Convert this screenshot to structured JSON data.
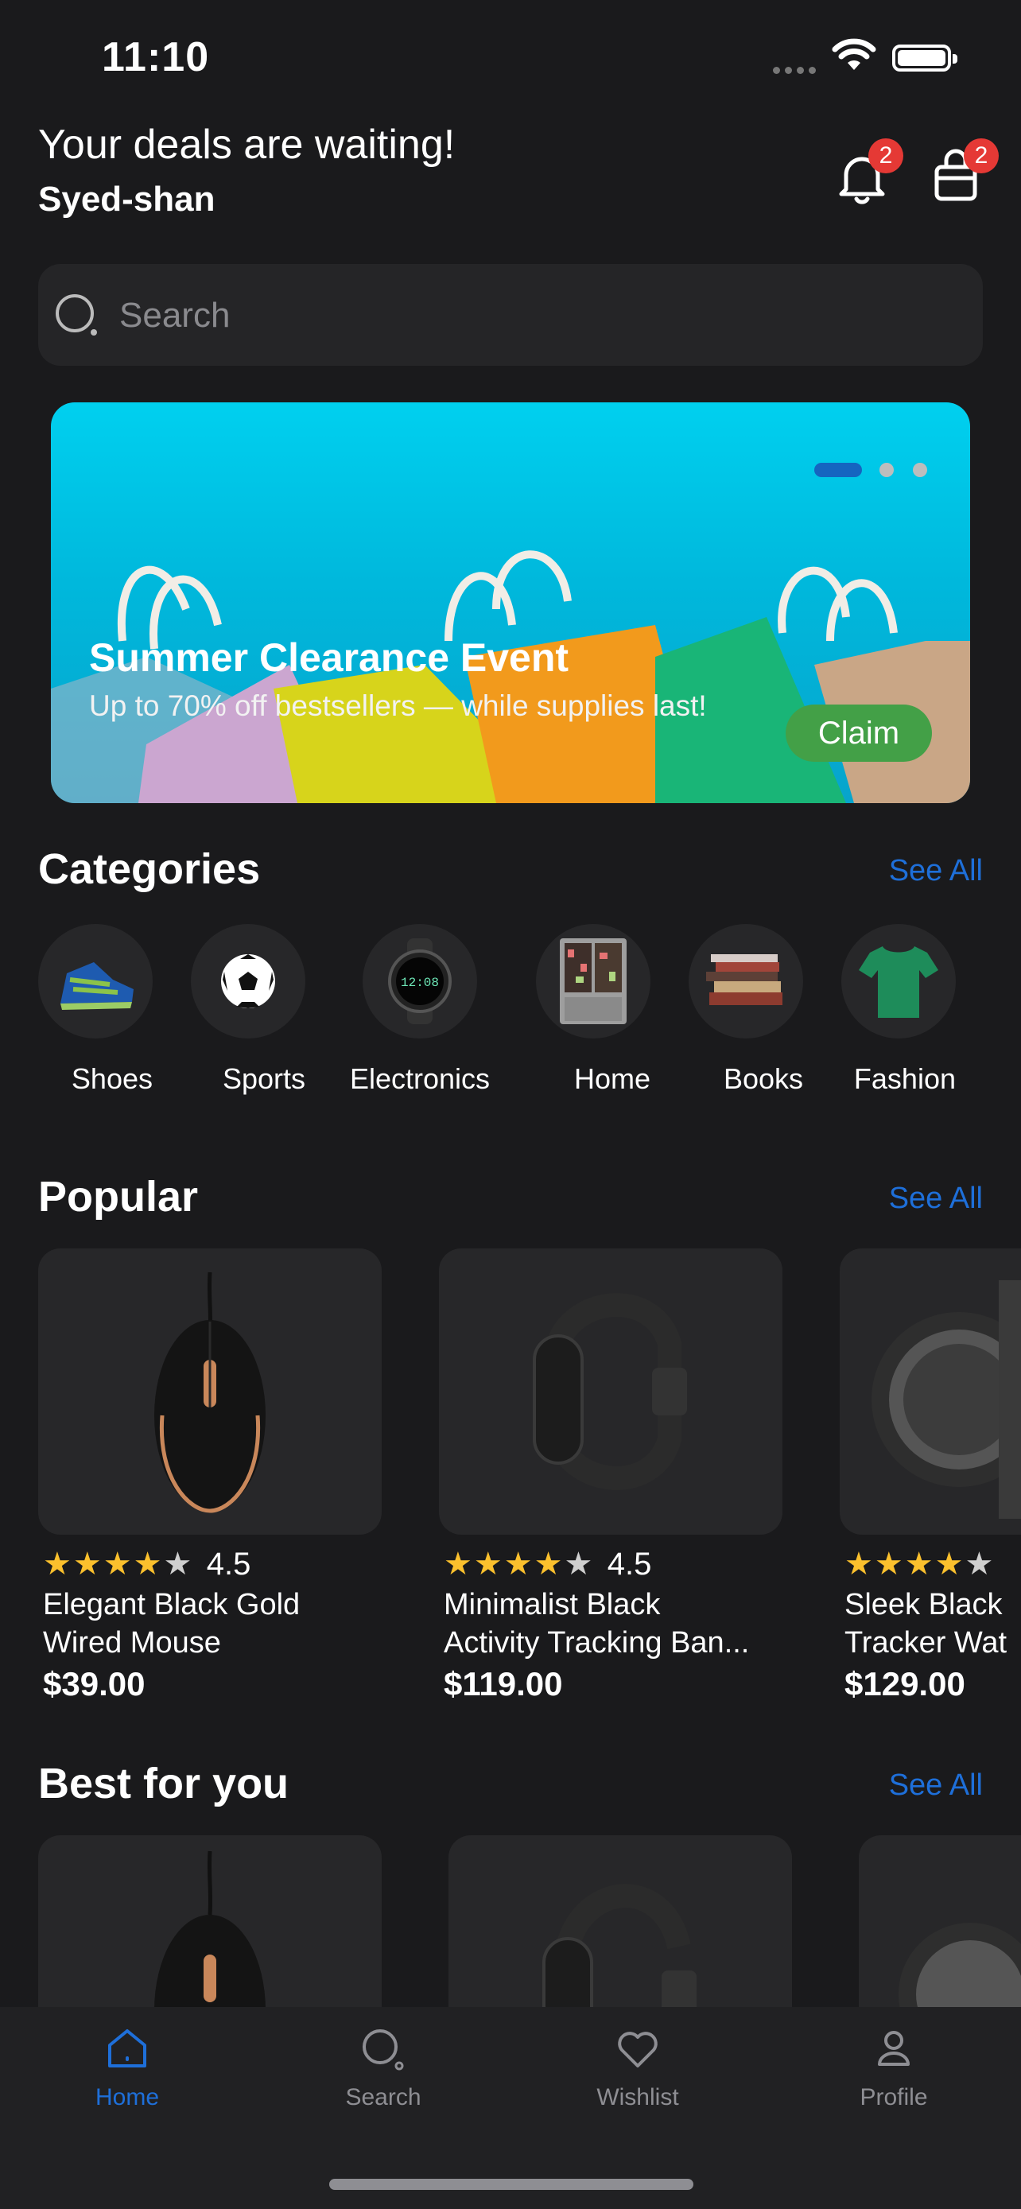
{
  "status_bar": {
    "time": "11:10"
  },
  "header": {
    "greeting": "Your deals are waiting!",
    "username": "Syed-shan",
    "notifications_count": "2",
    "cart_count": "2"
  },
  "search": {
    "placeholder": "Search"
  },
  "banner": {
    "title": "Summer Clearance Event",
    "subtitle": "Up to 70% off bestsellers — while supplies last!",
    "cta_label": "Claim",
    "active_slide": 1,
    "slide_count": 3
  },
  "categories": {
    "title": "Categories",
    "see_all": "See All",
    "items": [
      {
        "label": "Shoes",
        "icon": "shoe-icon"
      },
      {
        "label": "Sports",
        "icon": "soccer-ball-icon"
      },
      {
        "label": "Electronics",
        "icon": "smartwatch-icon"
      },
      {
        "label": "Home",
        "icon": "refrigerator-icon"
      },
      {
        "label": "Books",
        "icon": "books-icon"
      },
      {
        "label": "Fashion",
        "icon": "tshirt-icon"
      }
    ]
  },
  "popular": {
    "title": "Popular",
    "see_all": "See All",
    "products": [
      {
        "rating": "4.5",
        "name_line1": "Elegant Black Gold",
        "name_line2": "Wired Mouse",
        "price": "$39.00"
      },
      {
        "rating": "4.5",
        "name_line1": "Minimalist Black",
        "name_line2": "Activity Tracking Ban...",
        "price": "$119.00"
      },
      {
        "rating": "",
        "name_line1": "Sleek Black",
        "name_line2": "Tracker Wat",
        "price": "$129.00"
      }
    ]
  },
  "best_for_you": {
    "title": "Best for you",
    "see_all": "See All"
  },
  "bottom_nav": {
    "items": [
      {
        "label": "Home",
        "active": true
      },
      {
        "label": "Search",
        "active": false
      },
      {
        "label": "Wishlist",
        "active": false
      },
      {
        "label": "Profile",
        "active": false
      }
    ]
  },
  "colors": {
    "accent": "#1e6fd9",
    "badge": "#e53935",
    "cta": "#43a047",
    "star": "#fbc02d",
    "background": "#1a1a1c"
  }
}
